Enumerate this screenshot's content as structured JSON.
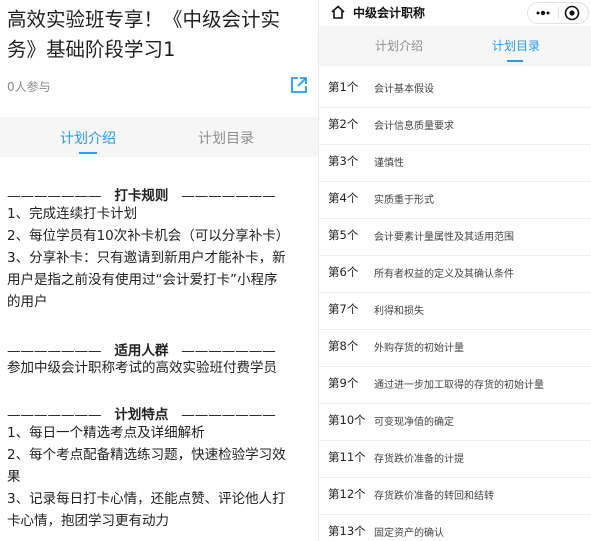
{
  "left": {
    "title_lines": [
      "高效实验班专享！《中级会计实",
      "务》基础阶段学习1"
    ],
    "participants": "0人参与",
    "tabs": [
      "计划介绍",
      "计划目录"
    ],
    "sections": [
      {
        "heading": "打卡规则",
        "lines": [
          "1、完成连续打卡计划",
          "2、每位学员有10次补卡机会（可以分享补卡）",
          "3、分享补卡：只有邀请到新用户才能补卡，新",
          "用户是指之前没有使用过“会计爱打卡”小程序",
          "的用户"
        ]
      },
      {
        "heading": "适用人群",
        "lines": [
          "参加中级会计职称考试的高效实验班付费学员"
        ]
      },
      {
        "heading": "计划特点",
        "lines": [
          "1、每日一个精选考点及详细解析",
          "2、每个考点配备精选练习题，快速检验学习效",
          "果",
          "3、记录每日打卡心情，还能点赞、评论他人打",
          "卡心情，抱团学习更有动力"
        ]
      }
    ],
    "dash_left": "———————",
    "dash_right": "———————"
  },
  "right": {
    "nav_title": "中级会计职称",
    "tabs": [
      "计划介绍",
      "计划目录"
    ],
    "rows": [
      {
        "num": "第1个",
        "title": "会计基本假设"
      },
      {
        "num": "第2个",
        "title": "会计信息质量要求"
      },
      {
        "num": "第3个",
        "title": "谨慎性"
      },
      {
        "num": "第4个",
        "title": "实质重于形式"
      },
      {
        "num": "第5个",
        "title": "会计要素计量属性及其适用范围"
      },
      {
        "num": "第6个",
        "title": "所有者权益的定义及其确认条件"
      },
      {
        "num": "第7个",
        "title": "利得和损失"
      },
      {
        "num": "第8个",
        "title": "外购存货的初始计量"
      },
      {
        "num": "第9个",
        "title": "通过进一步加工取得的存货的初始计量"
      },
      {
        "num": "第10个",
        "title": "可变现净值的确定"
      },
      {
        "num": "第11个",
        "title": "存货跌价准备的计提"
      },
      {
        "num": "第12个",
        "title": "存货跌价准备的转回和结转"
      },
      {
        "num": "第13个",
        "title": "固定资产的确认"
      }
    ]
  },
  "colors": {
    "accent": "#2a9af0",
    "tab_bg": "#f6f6f6",
    "muted": "#8d8d8d"
  },
  "icons": [
    "share-icon",
    "home-icon",
    "more-icon",
    "close-icon"
  ]
}
